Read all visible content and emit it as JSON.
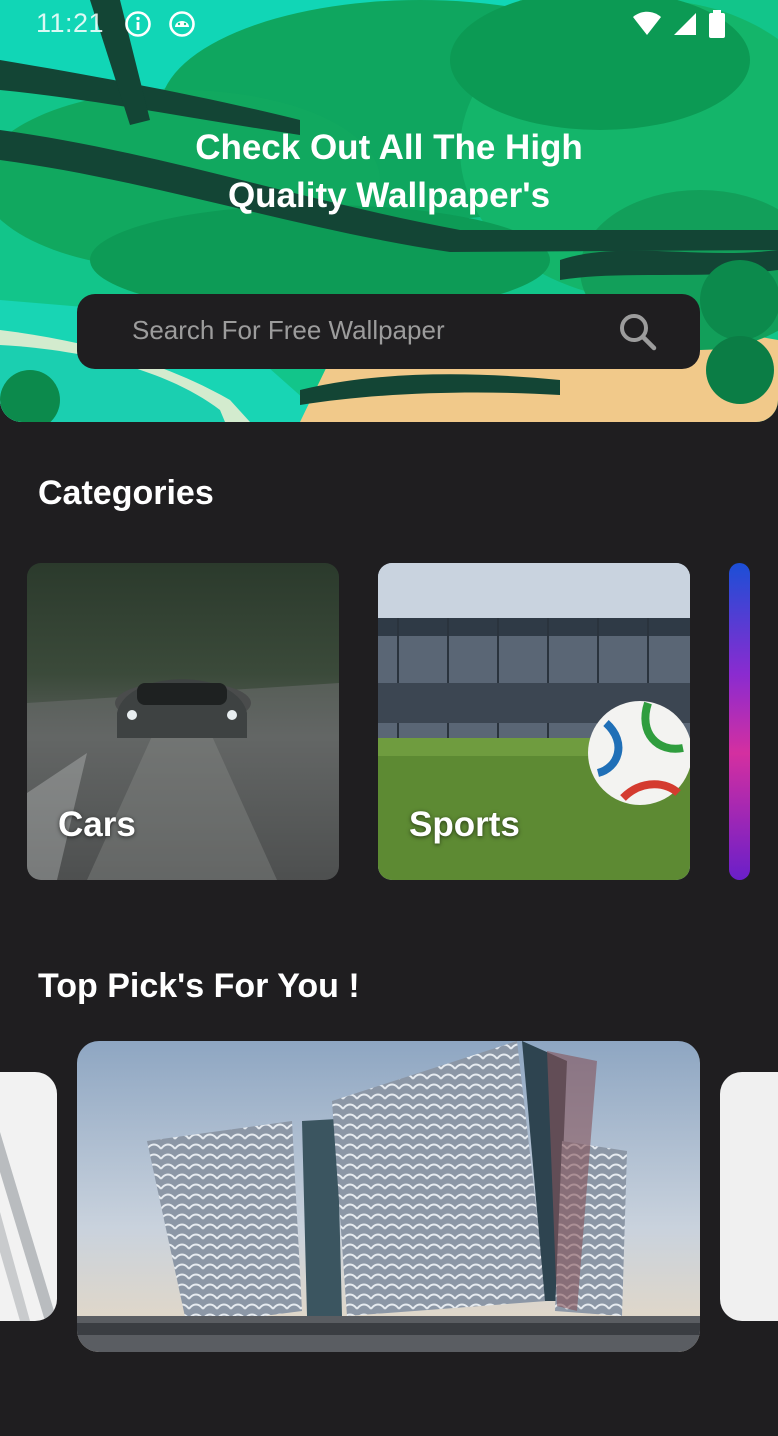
{
  "status_bar": {
    "time": "11:21",
    "icons": [
      "info-icon",
      "android-icon",
      "wifi-icon",
      "cellular-signal-icon",
      "battery-icon"
    ]
  },
  "hero": {
    "title_line1": "Check Out All The High",
    "title_line2": "Quality Wallpaper's"
  },
  "search": {
    "placeholder": "Search For Free Wallpaper",
    "icon": "search-icon"
  },
  "categories": {
    "title": "Categories",
    "items": [
      {
        "label": "Cars"
      },
      {
        "label": "Sports"
      },
      {
        "label": ""
      }
    ]
  },
  "top_picks": {
    "title": "Top Pick's For You !"
  },
  "colors": {
    "background": "#1f1e20",
    "hero_green": "#16b06e",
    "hero_teal": "#10d3b0",
    "search_bg": "#1f1e20",
    "placeholder": "#9c9c9c"
  }
}
